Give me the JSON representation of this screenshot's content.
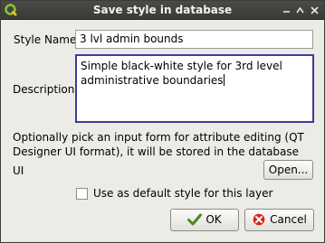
{
  "window": {
    "title": "Save style in database"
  },
  "form": {
    "style_name_label": "Style Name",
    "style_name_value": "3 lvl admin bounds",
    "description_label": "Description",
    "description_value": "Simple black-white style for 3rd level administrative boundaries",
    "info_text": "Optionally pick an input form for attribute editing (QT Designer UI format), it will be stored in the database",
    "ui_label": "UI",
    "open_button": "Open...",
    "default_checkbox_label": "Use as default style for this layer",
    "default_checked": false
  },
  "buttons": {
    "ok_label": "OK",
    "cancel_label": "Cancel"
  },
  "icons": {
    "app": "qgis-logo-icon",
    "ok": "check-icon",
    "cancel": "cancel-x-icon"
  }
}
